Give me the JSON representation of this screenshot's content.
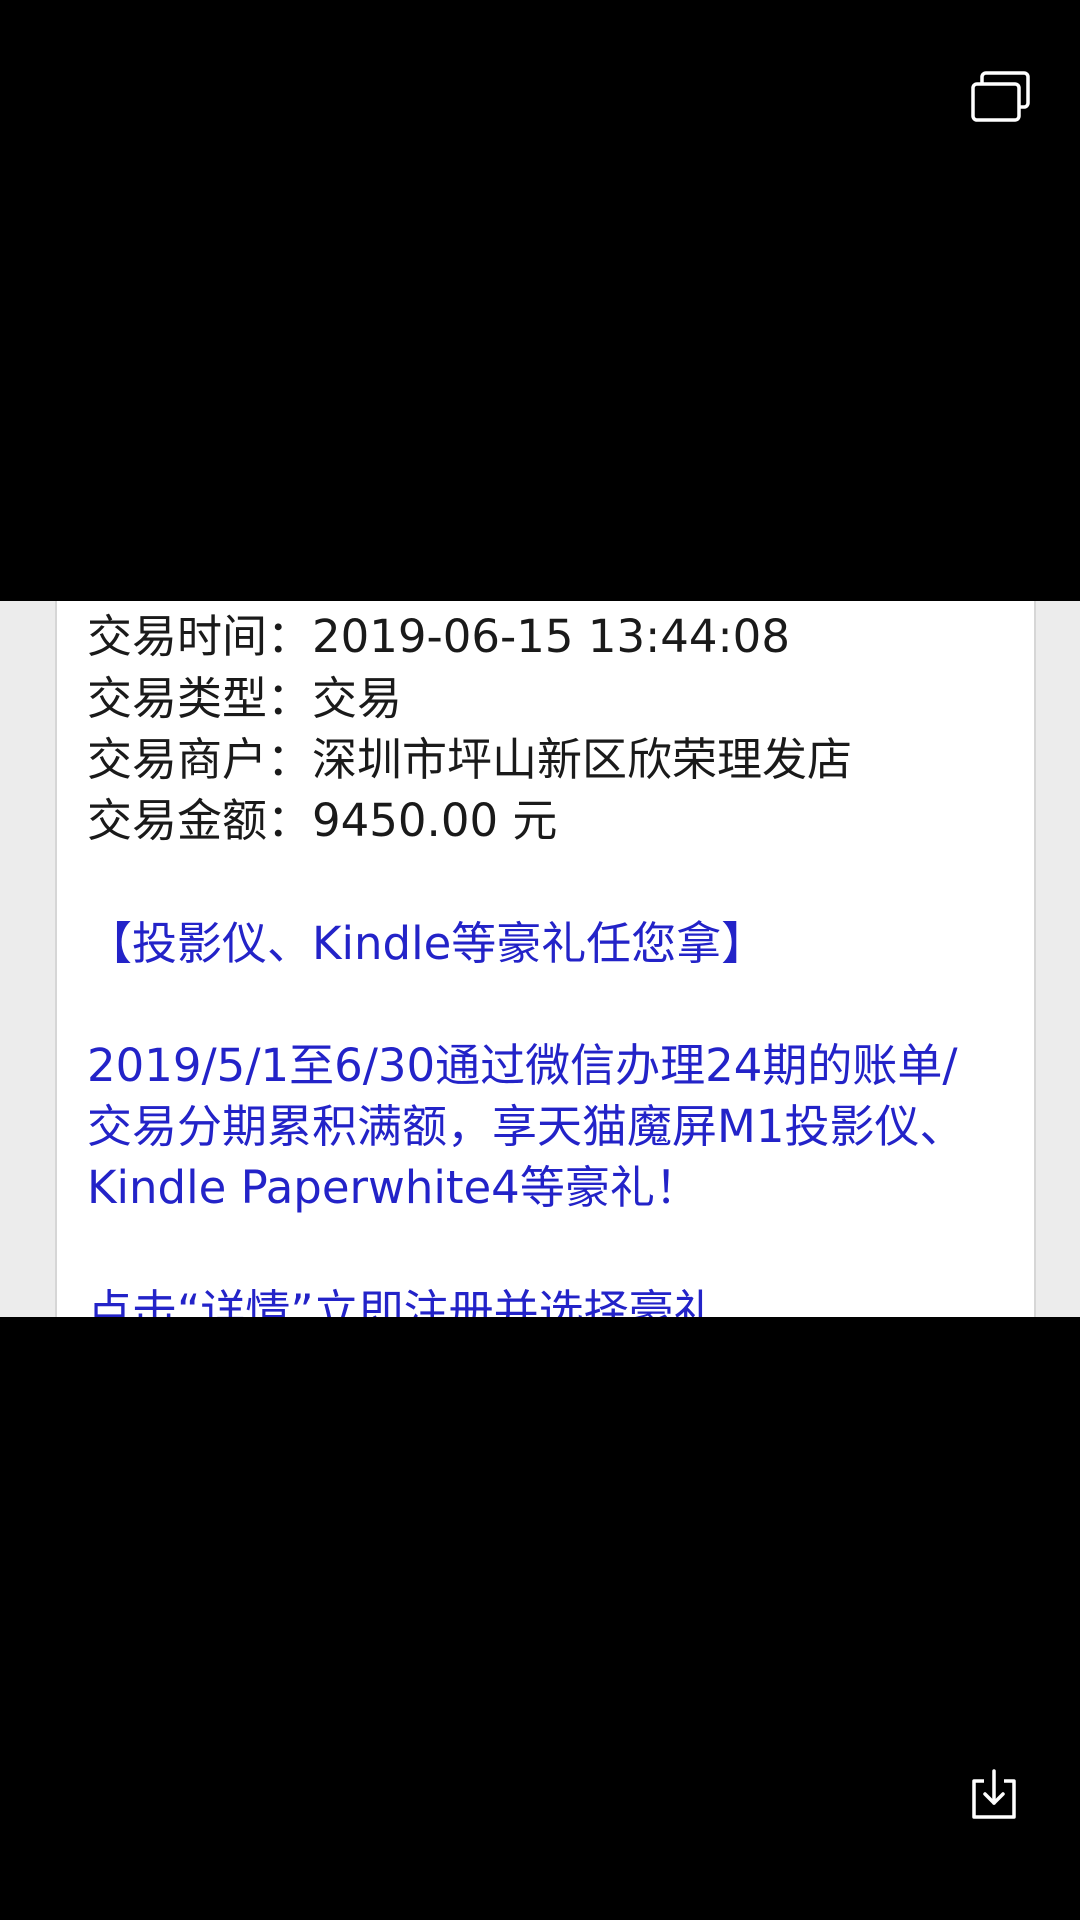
{
  "viewer": {
    "top_icon": "multiple-windows-icon",
    "bottom_icon": "download-icon"
  },
  "transaction": {
    "time_label": "交易时间：",
    "time_value": "2019-06-15 13:44:08",
    "type_label": "交易类型：",
    "type_value": "交易",
    "merchant_label": "交易商户：",
    "merchant_value": "深圳市坪山新区欣荣理发店",
    "amount_label": "交易金额：",
    "amount_value": "9450.00 元"
  },
  "promo": {
    "title": "【投影仪、Kindle等豪礼任您拿】",
    "body_line1": "2019/5/1至6/30通过微信办理24期的账单/",
    "body_line2": "交易分期累积满额，享天猫魔屏M1投影仪、",
    "body_line3": "Kindle Paperwhite4等豪礼！",
    "link_text": "点击“详情”立即注册并选择豪礼"
  },
  "colors": {
    "background": "#000000",
    "paper": "#ffffff",
    "text": "#1a1a1a",
    "promo_text": "#2323c8",
    "icon": "#ffffff"
  }
}
